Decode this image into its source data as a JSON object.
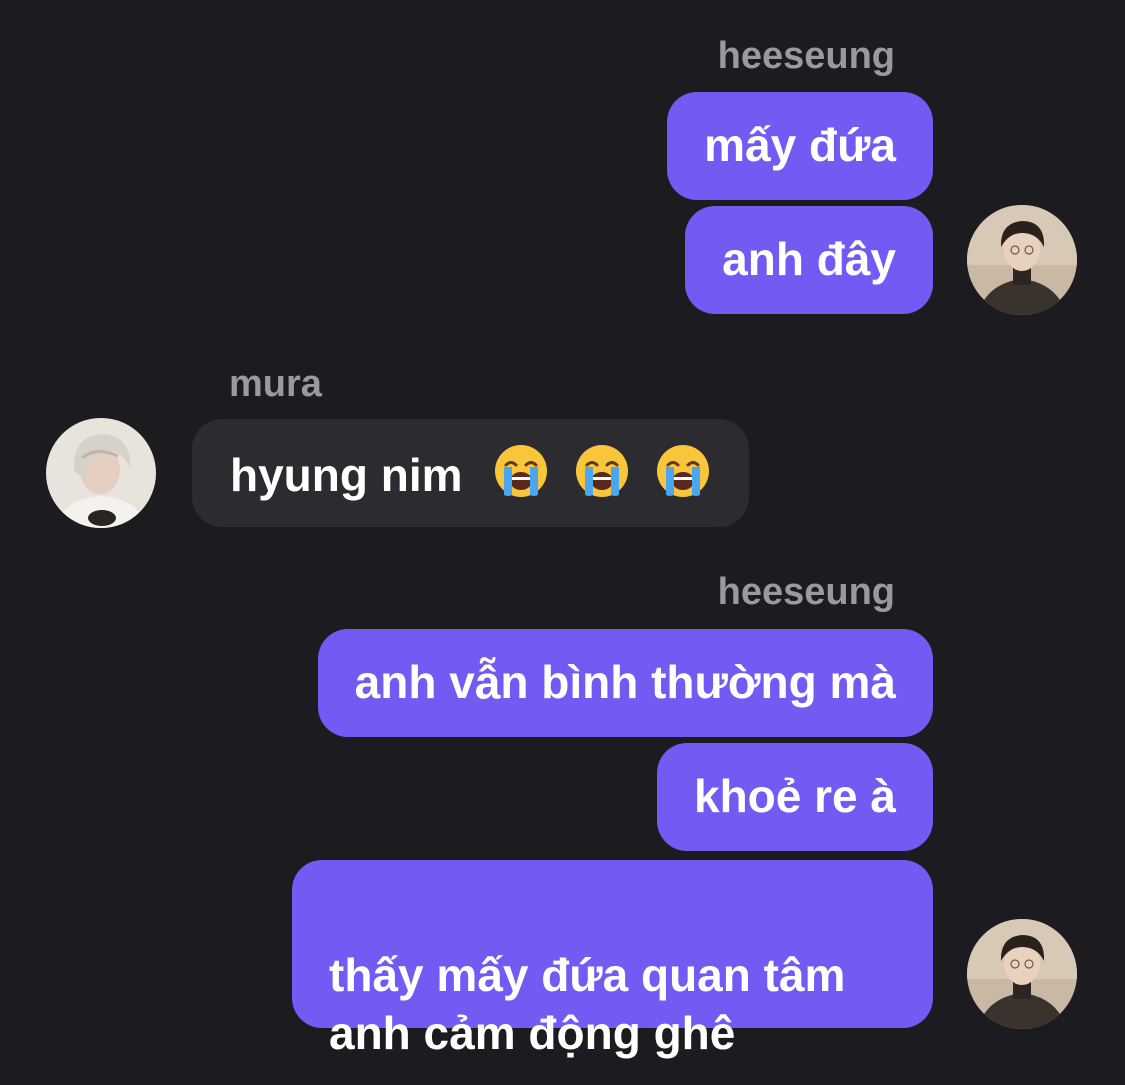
{
  "messages": [
    {
      "sender": "heeseung",
      "bubbles": [
        "mấy đứa",
        "anh đây"
      ]
    },
    {
      "sender": "mura",
      "bubbles": [
        "hyung nim"
      ],
      "emoji": [
        "loudly-crying-face",
        "loudly-crying-face",
        "loudly-crying-face"
      ]
    },
    {
      "sender": "heeseung",
      "bubbles": [
        "anh vẫn bình thường mà",
        "khoẻ re à",
        "thấy mấy đứa quan tâm\nanh cảm động ghê"
      ]
    }
  ],
  "colors": {
    "background": "#1c1b20",
    "outgoing_bubble": "#735af2",
    "incoming_bubble": "#2c2b30",
    "sender_name": "#9a999f",
    "text": "#ffffff"
  }
}
